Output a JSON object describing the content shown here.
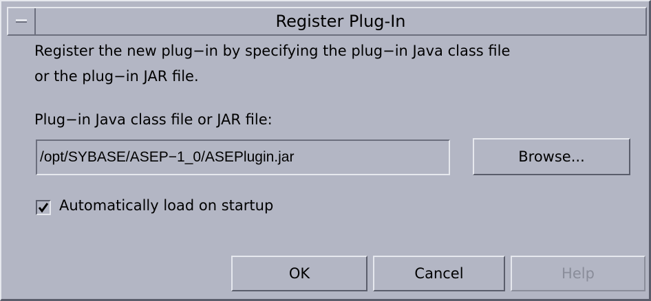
{
  "dialog": {
    "title": "Register Plug-In",
    "description_line1": "Register the new plug−in by specifying the plug−in Java class file",
    "description_line2": "or the plug−in JAR file.",
    "field_label": "Plug−in Java class file or JAR file:",
    "file_path": "/opt/SYBASE/ASEP−1_0/ASEPlugin.jar",
    "browse_label": "Browse...",
    "auto_load_label": "Automatically load on startup",
    "auto_load_checked": true,
    "ok_label": "OK",
    "cancel_label": "Cancel",
    "help_label": "Help",
    "help_enabled": false
  }
}
